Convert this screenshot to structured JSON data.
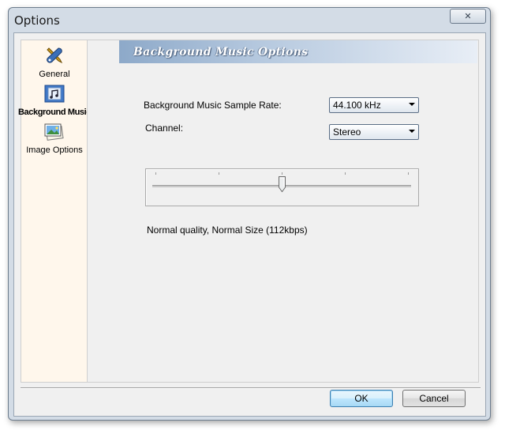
{
  "window": {
    "title": "Options",
    "close_glyph": "✕"
  },
  "sidebar": {
    "items": [
      {
        "label": "General",
        "icon": "tools-icon",
        "selected": false
      },
      {
        "label": "Background Music",
        "icon": "music-file-icon",
        "selected": true
      },
      {
        "label": "Image Options",
        "icon": "image-options-icon",
        "selected": false
      }
    ]
  },
  "panel": {
    "banner_title": "Background Music Options",
    "sample_rate": {
      "label": "Background Music Sample Rate:",
      "value": "44.100 kHz"
    },
    "channel": {
      "label": "Channel:",
      "value": "Stereo"
    },
    "quality_slider": {
      "level": 0.5,
      "tick_count": 5
    },
    "quality_text": "Normal quality, Normal Size (112kbps)"
  },
  "buttons": {
    "ok": "OK",
    "cancel": "Cancel"
  },
  "colors": {
    "banner_start": "#8da9c9",
    "sidebar_bg": "#fff7ec",
    "default_button": "#3c7fb1"
  }
}
